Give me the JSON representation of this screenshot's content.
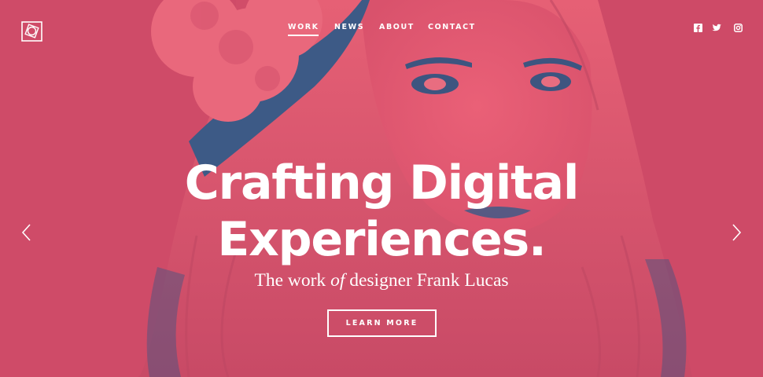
{
  "theme": {
    "overlay": "#d4506a",
    "shadow": "#3a5580",
    "text": "#ffffff"
  },
  "header": {
    "logo_icon": "square-circle-logo",
    "nav": [
      {
        "label": "WORK",
        "active": true
      },
      {
        "label": "NEWS",
        "active": false
      },
      {
        "label": "ABOUT",
        "active": false
      },
      {
        "label": "CONTACT",
        "active": false
      }
    ],
    "social": [
      "facebook-icon",
      "twitter-icon",
      "instagram-icon"
    ]
  },
  "hero": {
    "headline_line1": "Crafting Digital",
    "headline_line2": "Experiences.",
    "subtitle_before": "The work ",
    "subtitle_em": "of",
    "subtitle_after": " designer Frank Lucas",
    "cta_label": "LEARN MORE"
  },
  "slider": {
    "prev_icon": "chevron-left-icon",
    "next_icon": "chevron-right-icon"
  }
}
